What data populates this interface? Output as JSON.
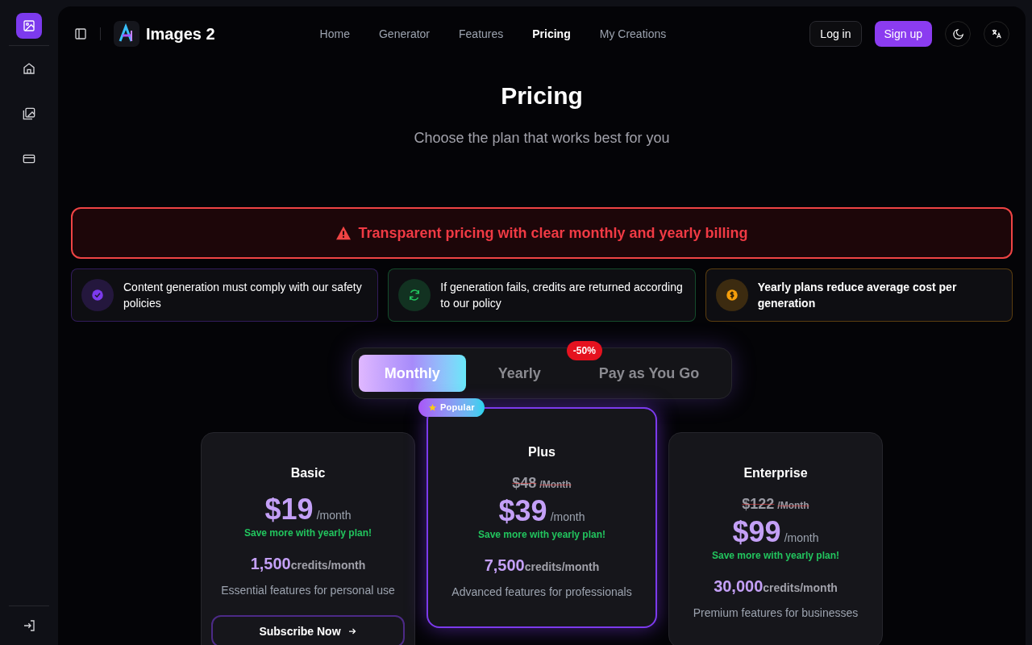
{
  "brand": {
    "name": "Images 2"
  },
  "nav": [
    {
      "label": "Home",
      "selected": false
    },
    {
      "label": "Generator",
      "selected": false
    },
    {
      "label": "Features",
      "selected": false
    },
    {
      "label": "Pricing",
      "selected": true
    },
    {
      "label": "My Creations",
      "selected": false
    }
  ],
  "auth": {
    "login": "Log in",
    "signup": "Sign up"
  },
  "heading": {
    "title": "Pricing",
    "subtitle": "Choose the plan that works best for you"
  },
  "notice": "Transparent pricing with clear monthly and yearly billing",
  "info_cards": [
    {
      "kind": "check",
      "text": "Content generation must comply with our safety policies",
      "color": "#7c3aed",
      "bold": false
    },
    {
      "kind": "refresh",
      "text": "If generation fails, credits are returned according to our policy",
      "color": "#22c55e",
      "bold": false
    },
    {
      "kind": "coin",
      "text": "Yearly plans reduce average cost per generation",
      "color": "#f59e0b",
      "bold": true
    }
  ],
  "billing_tabs": [
    {
      "label": "Monthly",
      "selected": true
    },
    {
      "label": "Yearly",
      "selected": false,
      "badge": "-50%"
    },
    {
      "label": "Pay as You Go",
      "selected": false
    }
  ],
  "plans": [
    {
      "name": "Basic",
      "popular": false,
      "price": "$19",
      "period": "/month",
      "save_note": "Save more with yearly plan!",
      "credits": "1,500",
      "credits_unit": "credits/month",
      "description": "Essential features for personal use",
      "button": "Subscribe Now"
    },
    {
      "name": "Plus",
      "popular": true,
      "badge": "Popular",
      "old_price": "$48",
      "old_period": "/Month",
      "price": "$39",
      "period": "/month",
      "save_note": "Save more with yearly plan!",
      "credits": "7,500",
      "credits_unit": "credits/month",
      "description": "Advanced features for professionals"
    },
    {
      "name": "Enterprise",
      "popular": false,
      "old_price": "$122",
      "old_period": "/Month",
      "price": "$99",
      "period": "/month",
      "save_note": "Save more with yearly plan!",
      "credits": "30,000",
      "credits_unit": "credits/month",
      "description": "Premium features for businesses"
    }
  ]
}
